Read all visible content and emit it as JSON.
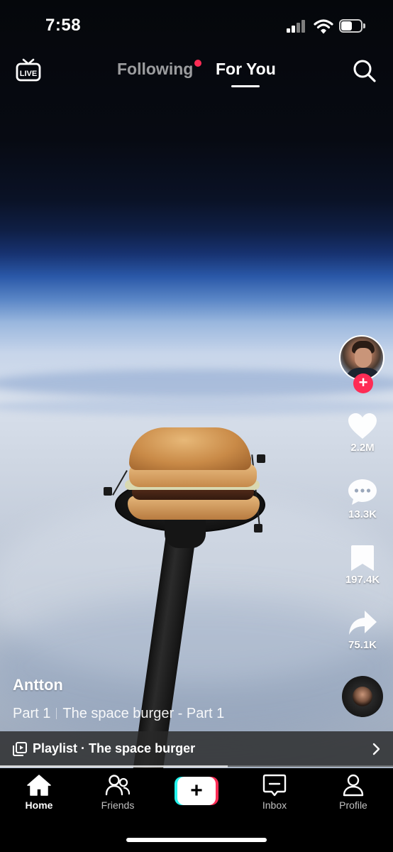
{
  "status_bar": {
    "time": "7:58",
    "battery_level": 0.55
  },
  "top_nav": {
    "live_label": "LIVE",
    "tabs": [
      {
        "label": "Following",
        "has_notification_dot": true,
        "active": false
      },
      {
        "label": "For You",
        "active": true
      }
    ],
    "icons": {
      "live": "live-tv-icon",
      "search": "search-icon"
    }
  },
  "video": {
    "author": "Antton",
    "caption": {
      "part": "Part 1",
      "title": "The space burger - Part 1"
    },
    "playlist": {
      "label": "Playlist · The space burger"
    },
    "progress": 0.58
  },
  "actions": {
    "follow_label": "+",
    "likes": "2.2M",
    "comments": "13.3K",
    "saves": "197.4K",
    "shares": "75.1K"
  },
  "bottom_nav": {
    "items": [
      {
        "label": "Home",
        "icon": "home-icon",
        "active": true
      },
      {
        "label": "Friends",
        "icon": "friends-icon",
        "active": false
      },
      {
        "label": "+",
        "icon": "create-icon",
        "active": false
      },
      {
        "label": "Inbox",
        "icon": "inbox-icon",
        "active": false
      },
      {
        "label": "Profile",
        "icon": "profile-icon",
        "active": false
      }
    ]
  },
  "colors": {
    "accent": "#fe2c55",
    "cyan": "#25f4ee",
    "background": "#000000"
  }
}
